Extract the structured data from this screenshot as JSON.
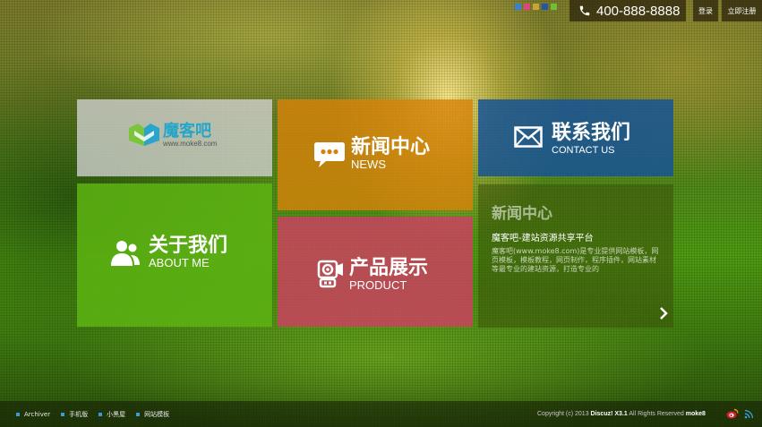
{
  "header": {
    "swatches": [
      "#3a7fd5",
      "#e0457b",
      "#c8a23a",
      "#2257a8",
      "#6fbf3a"
    ],
    "phone": "400-888-8888",
    "login": "登录",
    "register": "立即注册"
  },
  "logo_tile": {
    "name": "魔客吧",
    "url": "www.moke8.com"
  },
  "tiles": {
    "about": {
      "title": "关于我们",
      "subtitle": "ABOUT ME",
      "color": "#5cb212"
    },
    "news": {
      "title": "新闻中心",
      "subtitle": "NEWS",
      "color": "#d6820a"
    },
    "product": {
      "title": "产品展示",
      "subtitle": "PRODUCT",
      "color": "#ce4062"
    },
    "contact": {
      "title": "联系我们",
      "subtitle": "CONTACT US",
      "color": "#1654a0"
    }
  },
  "news_box": {
    "heading": "新闻中心",
    "headline": "魔客吧-建站资源共享平台",
    "body": "魔客吧(www.moke8.com)是专业提供网站模板，网页模板，模板教程，网页制作，程序插件，网站素材等最专业的建站资源，打造专业的"
  },
  "footer": {
    "links": [
      "Archiver",
      "手机版",
      "小黑屋",
      "网站模板"
    ],
    "copyright_prefix": "Copyright (c) 2013 ",
    "copyright_product": "Discuz! X3.1",
    "copyright_middle": "  All Rights Reserved ",
    "copyright_owner": "moke8"
  }
}
